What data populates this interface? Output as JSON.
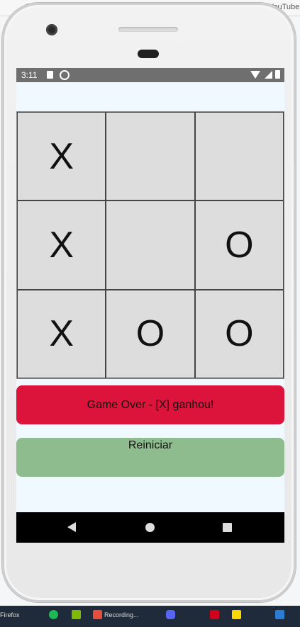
{
  "desktop": {
    "tabs": [
      {
        "text": "",
        "color": "#e8453c"
      },
      {
        "text": "YouTube",
        "color": "#b5e61d"
      }
    ],
    "taskbar": [
      {
        "text": "Firefox"
      },
      {
        "text": "Recording..."
      }
    ]
  },
  "statusbar": {
    "time": "3:11"
  },
  "board": {
    "cells": [
      "X",
      "",
      "",
      "X",
      "",
      "O",
      "X",
      "O",
      "O"
    ]
  },
  "game": {
    "status_text": "Game Over - [X] ganhou!",
    "status_color": "#dc143c",
    "reset_label": "Reiniciar",
    "reset_color": "#8fbc8f"
  },
  "navbar": {
    "back_icon": "back-icon",
    "home_icon": "home-icon",
    "recents_icon": "recents-icon"
  }
}
